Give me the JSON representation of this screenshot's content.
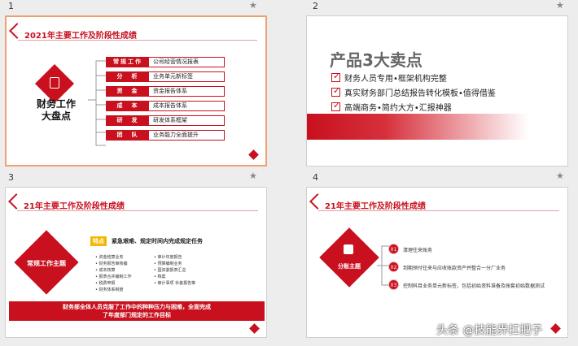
{
  "slides": [
    {
      "number": "1",
      "header": "2021年主要工作及阶段性成绩",
      "center_title": "财务工作\n大盘点",
      "rows": [
        {
          "key": "常规工作",
          "value": "公司经营情况报表"
        },
        {
          "key": "分　析",
          "value": "业务单元新标签"
        },
        {
          "key": "资　金",
          "value": "资金报告体系"
        },
        {
          "key": "成　本",
          "value": "成本报告体系"
        },
        {
          "key": "研　发",
          "value": "研发体系框架"
        },
        {
          "key": "团　队",
          "value": "业务能力全面提升"
        }
      ]
    },
    {
      "number": "2",
      "title": "产品3大卖点",
      "points": [
        "财务人员专用•框架机构完整",
        "真实财务部门总结报告转化模板•值得借鉴",
        "高端商务•简约大方•汇报神器"
      ]
    },
    {
      "number": "3",
      "header": "21年主要工作及阶段性成绩",
      "diamond_label": "常规工作主题",
      "tag": "特点",
      "subtitle": "紧急艰难、规定时间内完成规定任务",
      "bullets_left": [
        "• 资金结算业务",
        "• 财务报告审核编",
        "• 成本核算",
        "• 报表合并编制工作",
        "• 税费申报",
        "• 财务体系制度"
      ],
      "bullets_right": [
        "• 审计年度报告",
        "• 预算编制业务",
        "• 国资委报表汇总",
        "• 档案",
        "• 审计事项 补差报告等"
      ],
      "banner": "财务部全体人员克服了工作中的种种压力与困难，全面完成\n了年度部门规定的工作目标"
    },
    {
      "number": "4",
      "header": "21年主要工作及阶段性成绩",
      "diamond_label": "分账主题",
      "items": [
        {
          "num": "01",
          "text": "清理往来账务"
        },
        {
          "num": "02",
          "text": "到期预付往来与应收账款资产并整合一分厂业务"
        },
        {
          "num": "03",
          "text": "控制科目业务单元新标签，包括初始资料准备及账套初始数据测试"
        }
      ]
    }
  ],
  "watermark": "头条 @技能界扛把子",
  "star_icon": "★",
  "accent": "#c8101e"
}
